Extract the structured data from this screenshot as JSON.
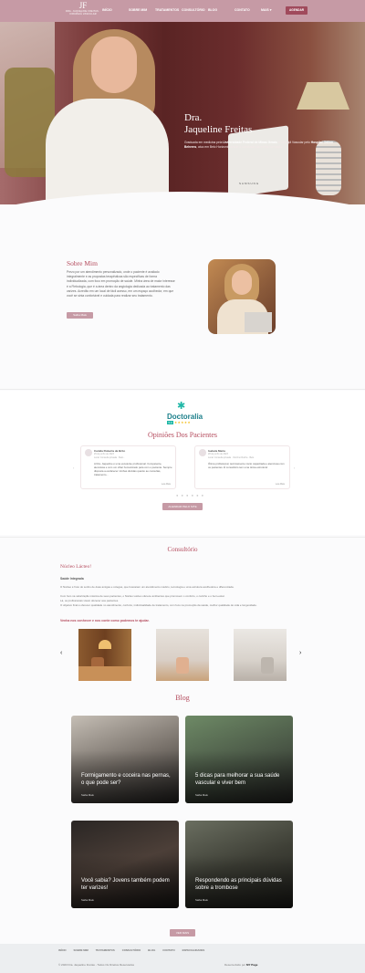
{
  "header": {
    "logo_mark": "JF",
    "logo_text": "DRA. JAQUELINE FREITAS · CIRURGIÃ VASCULAR",
    "nav": [
      "INÍCIO",
      "SOBRE MIM",
      "TRATAMENTOS",
      "CONSULTÓRIO",
      "BLOG",
      "CONTATO",
      "MAIS ▾"
    ],
    "cta": "AGENDAR"
  },
  "hero": {
    "title_line1": "Dra.",
    "title_line2": "Jaqueline Freitas",
    "text_prefix": "Graduada em medicina pela ",
    "text_bold1": "Universidade Federal de Minas Gerais",
    "text_mid": " e Cirurgiã Vascular pelo ",
    "text_bold2": "Hospital Odilon Behrens",
    "text_suffix": ", atuo em Belo Horizonte desde a conclusão da minha formação.",
    "laptop_brand": "SAMSUNG"
  },
  "about": {
    "title": "Sobre Mim",
    "text": "Prezo por um atendimento personalizado, onde o paciente é avaliado integralmente e as propostas terapêuticas são específicas de forma individualizada, com foco em promoção de saúde. Minha área de maior interesse é a Flebologia, que é a área dentro da angiologia dedicada ao tratamento das varizes. Acredito em um local de fácil acesso, em um espaço acolhedor, em que você se sinta confortável e cuidada para realizar seu tratamento.",
    "button": "Saiba Mais"
  },
  "reviews": {
    "brand": "Doctoralia",
    "badge": "5.0",
    "stars": "★★★★★",
    "title": "Opiniões Dos Pacientes",
    "cards": [
      {
        "name": "Camila Roberta de Brito",
        "date": "29 de junho de 2023",
        "place": "Local: Consulta privada · Belo...",
        "text": "A Dra. Jaqueline é uma excelente profissional. Competente, atenciosa e com um olhar humanizado para com o paciente. Sempre disposta a esclarecer minhas dúvidas quanto ao consultas, tratamento...",
        "link": "Leia Mais"
      },
      {
        "name": "Isabela Maria",
        "date": "28 de junho de 2023",
        "place": "Local: Consulta privada · Otorrino Rocha · Belo",
        "text": "Ótima profissional, tecnicamente muito capacitada e atenciosa com os pacientes. É consultório tem uma ótima estrutura!",
        "link": "Leia Mais"
      }
    ],
    "dots": "● ● ● ● ● ●",
    "button": "AGENDAR PELO SITE"
  },
  "office": {
    "title": "Consultório",
    "subtitle": "Núcleo Lácteo!",
    "heading": "Saúde Integrada",
    "p1": "O Núcleo é fruto do sonho de duas amigas e colegas, que buscaram um atendimento médico, tecnologia e uma estrutura acolhedora e diferenciada.",
    "p2": "Com foco na valorização máxima de seus pacientes, o Núcleo Lácteo oferece ambientes que promovem o conforto, o carinho e o bem-estar.",
    "p3": "Lá, os profissionais visam oferecer aos pacientes.",
    "p4": "O objetivo final é oferecer qualidade no atendimento, conforto, individualidade de tratamento, com foco na promoção da saúde, melhor qualidade de vida e longevidade.",
    "cta": "Venha nos conhecer e nos conte como podemos te ajudar.",
    "prev": "‹",
    "next": "›"
  },
  "blog": {
    "title": "Blog",
    "posts": [
      {
        "title": "Formigamento e coceira nas pernas, o que pode ser?",
        "link": "Saiba Mais"
      },
      {
        "title": "5 dicas para melhorar a sua saúde vascular e viver bem",
        "link": "Saiba Mais"
      },
      {
        "title": "Você sabia? Jovens também podem ter varizes!",
        "link": "Saiba Mais"
      },
      {
        "title": "Respondendo as principais dúvidas sobre a trombose",
        "link": "Saiba Mais"
      }
    ],
    "button": "VER MAIS"
  },
  "footer": {
    "nav": [
      "INÍCIO",
      "SOBRE MIM",
      "TRATAMENTOS",
      "CONSULTÓRIO",
      "BLOG",
      "CONTATO",
      "ESPECIALIDADES"
    ],
    "copyright": "© 2023 Dra. Jaqueline Freitas - Todos Os Direitos Reservados",
    "dev_prefix": "Desenvolvido por ",
    "dev_brand": "MY Page"
  },
  "colors": {
    "brand": "#c69aa5",
    "accent": "#b44a5c",
    "cta": "#a04a5c"
  }
}
